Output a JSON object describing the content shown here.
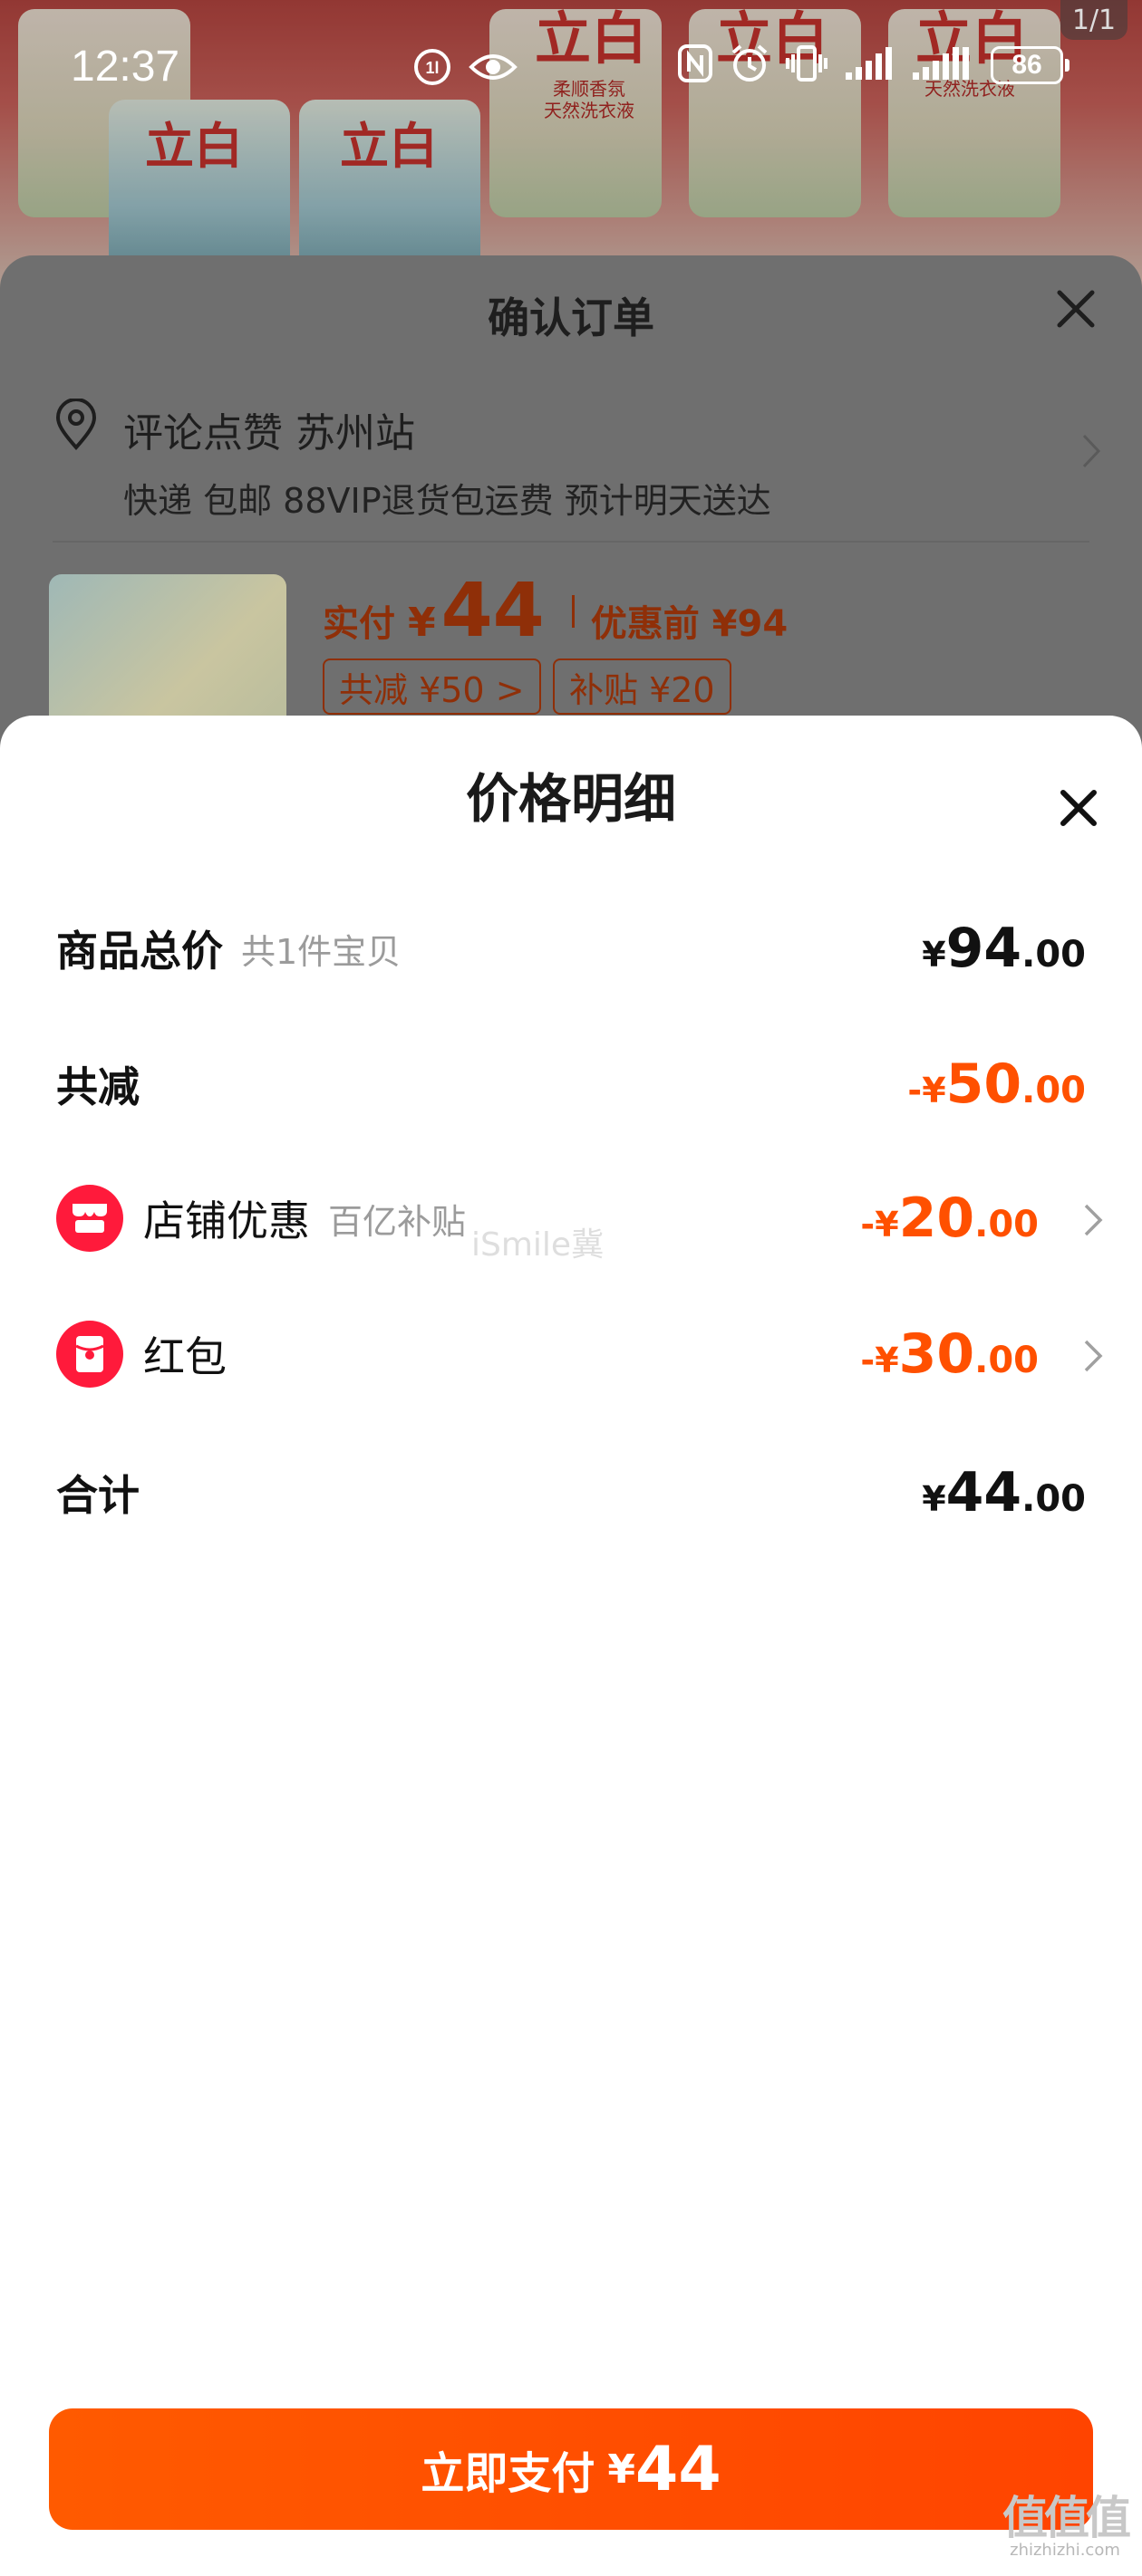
{
  "status_bar": {
    "time": "12:37",
    "battery": "86"
  },
  "banner": {
    "brand_text": "立白",
    "slogan_1": "柔顺香氛",
    "slogan_2": "天然洗衣液",
    "page_indicator": "1/1"
  },
  "order_sheet": {
    "title": "确认订单",
    "address_name": "评论点赞 苏州站",
    "address_sub": "快递 包邮 88VIP退货包运费 预计明天送达",
    "pay_label": "实付",
    "pay_yen": "¥",
    "pay_amount": "44",
    "original_label": "优惠前 ¥94",
    "chip_discount": "共减 ¥50 >",
    "chip_subsidy": "补贴 ¥20"
  },
  "detail": {
    "title": "价格明细",
    "rows": [
      {
        "label": "商品总价",
        "sub": "共1件宝贝",
        "yen": "¥",
        "int": "94",
        "dec": ".00",
        "prefix": ""
      },
      {
        "label": "共减",
        "sub": "",
        "yen": "¥",
        "int": "50",
        "dec": ".00",
        "prefix": "-"
      },
      {
        "label": "店铺优惠",
        "sub": "百亿补贴",
        "yen": "¥",
        "int": "20",
        "dec": ".00",
        "prefix": "-"
      },
      {
        "label": "红包",
        "sub": "",
        "yen": "¥",
        "int": "30",
        "dec": ".00",
        "prefix": "-"
      },
      {
        "label": "合计",
        "sub": "",
        "yen": "¥",
        "int": "44",
        "dec": ".00",
        "prefix": ""
      }
    ],
    "watermark": "iSmile冀"
  },
  "pay_button": {
    "label": "立即支付",
    "yen": "¥",
    "amount": "44"
  },
  "corner_logo": {
    "big": "值值值",
    "small": "zhizhizhi.com"
  },
  "colors": {
    "accent": "#ff5000",
    "badge": "#ff1a3b"
  }
}
